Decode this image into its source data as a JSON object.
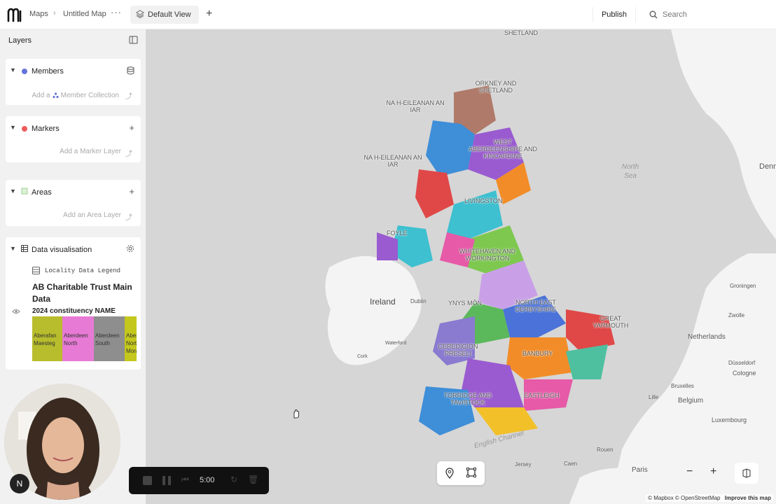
{
  "topbar": {
    "breadcrumb_maps": "Maps",
    "breadcrumb_sep": "›",
    "map_name": "Untitled Map",
    "more": "···",
    "tab_label": "Default View",
    "add_tab": "+",
    "publish": "Publish",
    "search_placeholder": "Search"
  },
  "sidebar": {
    "header": "Layers",
    "members": {
      "title": "Members",
      "add_prefix": "Add a",
      "add_link": "Member Collection",
      "dot_color": "#6674d9"
    },
    "markers": {
      "title": "Markers",
      "add_label": "Add a Marker Layer",
      "dot_color": "#ef5b5b"
    },
    "areas": {
      "title": "Areas",
      "add_label": "Add an Area Layer"
    },
    "data_vis": {
      "title": "Data visualisation",
      "legend_title": "Locality Data Legend",
      "dataset_title": "AB Charitable Trust Main Data",
      "column_name": "2024 constituency NAME",
      "swatches": [
        {
          "label": "Aberafan Maesteg",
          "color": "#b7bd2c"
        },
        {
          "label": "Aberdeen North",
          "color": "#e77ad5"
        },
        {
          "label": "Aberdeen South",
          "color": "#8e8e8e"
        },
        {
          "label": "Aberdeenshire North and Moray",
          "color": "#c4c81c"
        }
      ]
    }
  },
  "avatar_badge": "N",
  "player": {
    "time": "5:00"
  },
  "map": {
    "regions": [
      "SHETLAND",
      "ORKNEY AND SHETLAND",
      "NA H-EILEANAN AN IAR",
      "NA H-EILEANAN AN IAR",
      "WEST ABERDEENSHIRE AND KINCARDINE",
      "LIVINGSTON",
      "FOYLE",
      "WHITEHAVEN AND WORKINGTON",
      "YNYS MÔN",
      "NORTH EAST DERBYSHIRE",
      "GREAT YARMOUTH",
      "CEREDIGION PRESELI",
      "BANBURY",
      "TORRIDGE AND TAVISTOCK",
      "EASTLEIGH"
    ],
    "places": [
      "Ireland",
      "Dublin",
      "Waterford",
      "Cork",
      "Netherlands",
      "Belgium",
      "Luxembourg",
      "Bruxelles",
      "Paris",
      "Rouen",
      "Caen",
      "Jersey",
      "Denm",
      "Groningen",
      "Zwolle",
      "Düsseldorf",
      "Cologne",
      "Lille"
    ],
    "seas": [
      "North Sea",
      "English Channel"
    ],
    "attribution": "© Mapbox © OpenStreetMap",
    "improve": "Improve this map",
    "zoom_out": "−",
    "zoom_in": "+"
  },
  "colors": {
    "accent": "#6674d9",
    "land": "#f3f3f3",
    "sea": "#d6d6d6"
  }
}
